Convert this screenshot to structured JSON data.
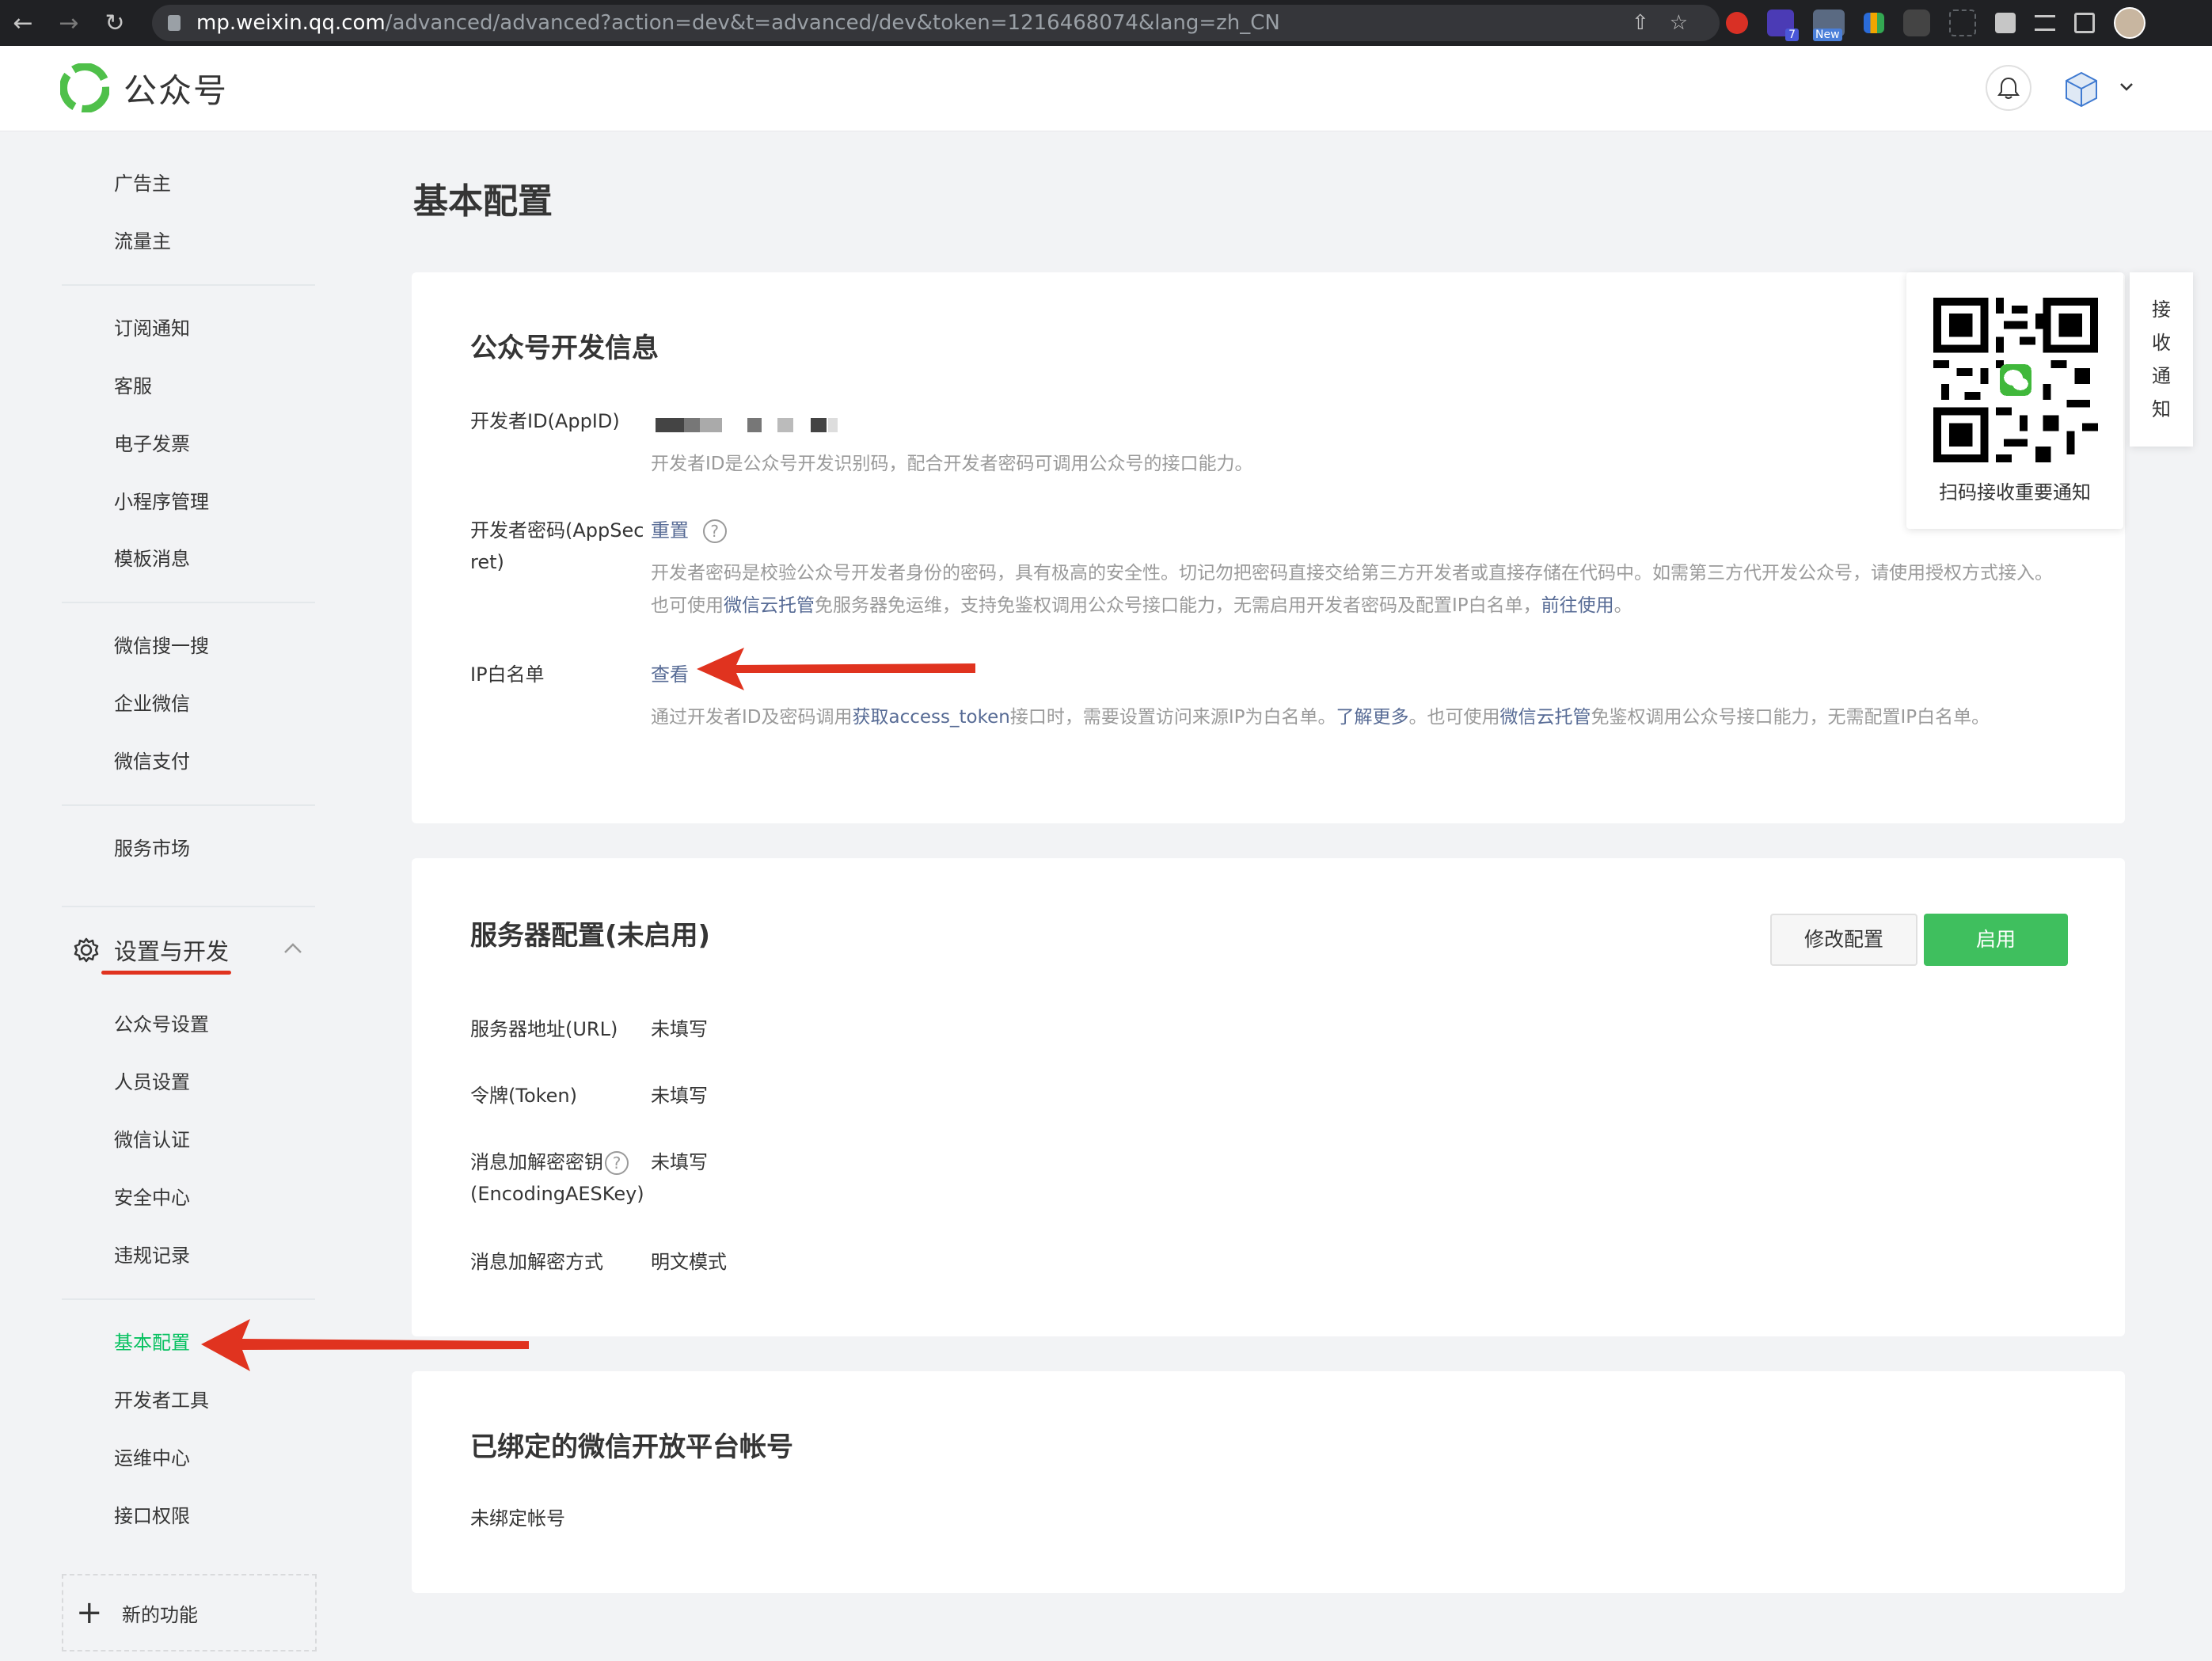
{
  "browser": {
    "url_host": "mp.weixin.qq.com",
    "url_path": "/advanced/advanced?action=dev&t=advanced/dev&token=1216468074&lang=zh_CN",
    "extension_badges": [
      "7",
      "New"
    ]
  },
  "header": {
    "brand": "公众号"
  },
  "sidebar": {
    "group1": [
      "广告主",
      "流量主"
    ],
    "group2": [
      "订阅通知",
      "客服",
      "电子发票",
      "小程序管理",
      "模板消息"
    ],
    "group3": [
      "微信搜一搜",
      "企业微信",
      "微信支付"
    ],
    "group4": [
      "服务市场"
    ],
    "section_title": "设置与开发",
    "section_items": [
      "公众号设置",
      "人员设置",
      "微信认证",
      "安全中心",
      "违规记录"
    ],
    "group6_active": "基本配置",
    "group6": [
      "开发者工具",
      "运维中心",
      "接口权限"
    ],
    "new_feature": "新的功能"
  },
  "main": {
    "page_title": "基本配置",
    "dev_info": {
      "title": "公众号开发信息",
      "appid_label": "开发者ID(AppID)",
      "appid_desc": "开发者ID是公众号开发识别码，配合开发者密码可调用公众号的接口能力。",
      "secret_label_line1": "开发者密码(AppSec",
      "secret_label_line2": "ret)",
      "secret_reset": "重置",
      "secret_desc_1": "开发者密码是校验公众号开发者身份的密码，具有极高的安全性。切记勿把密码直接交给第三方开发者或直接存储在代码中。如需第三方代开发公众号，请使用授权方式接入。 也可使用",
      "secret_desc_link1": "微信云托管",
      "secret_desc_2": "免服务器免运维，支持免鉴权调用公众号接口能力，无需启用开发者密码及配置IP白名单，",
      "secret_desc_link2": "前往使用",
      "secret_desc_3": "。",
      "ip_label": "IP白名单",
      "ip_view": "查看",
      "ip_desc_1": "通过开发者ID及密码调用",
      "ip_desc_link1": "获取access_token",
      "ip_desc_2": "接口时，需要设置访问来源IP为白名单。",
      "ip_desc_link2": "了解更多",
      "ip_desc_3": "。也可使用",
      "ip_desc_link3": "微信云托管",
      "ip_desc_4": "免鉴权调用公众号接口能力，无需配置IP白名单。"
    },
    "server": {
      "title": "服务器配置(未启用)",
      "modify_btn": "修改配置",
      "enable_btn": "启用",
      "rows": [
        {
          "label": "服务器地址(URL)",
          "value": "未填写"
        },
        {
          "label": "令牌(Token)",
          "value": "未填写"
        },
        {
          "label": "消息加解密密钥",
          "label2": "(EncodingAESKey)",
          "value": "未填写"
        },
        {
          "label": "消息加解密方式",
          "value": "明文模式"
        }
      ]
    },
    "open_platform": {
      "title": "已绑定的微信开放平台帐号",
      "status": "未绑定帐号"
    }
  },
  "qr_popup": {
    "caption": "扫码接收重要通知",
    "side_tab": [
      "接",
      "收",
      "通",
      "知"
    ]
  },
  "colors": {
    "accent_green": "#07c160",
    "button_green": "#3fbf5e",
    "link": "#576b95",
    "annotation_red": "#e0331f"
  }
}
